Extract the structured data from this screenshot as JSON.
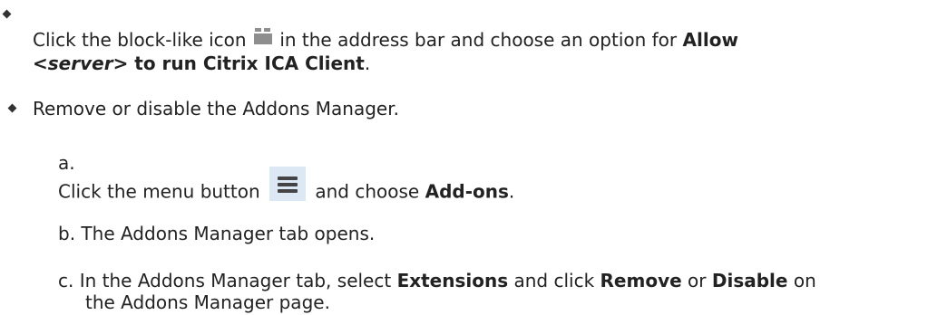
{
  "items": [
    {
      "line1_before": "Click the block-like icon",
      "line1_after": "in the address bar and choose an option for",
      "line1_bold": "Allow",
      "line2_bold_lt": "<",
      "line2_italic": "server",
      "line2_bold_rest": "> to run Citrix ICA Client",
      "line2_end": ".",
      "icon": "block-puzzle-icon"
    },
    {
      "text": "Remove or disable the Addons Manager."
    }
  ],
  "substeps": [
    {
      "marker": "a.",
      "before": "Click the menu button",
      "middle": "and choose",
      "bold": "Add-ons",
      "end": ".",
      "icon": "hamburger-menu-icon"
    },
    {
      "marker": "b.",
      "text": "The Addons Manager tab opens."
    },
    {
      "marker": "c.",
      "line1_before": "In the Addons Manager tab, select",
      "bold1": "Extensions",
      "mid1": "and click",
      "bold2": "Remove",
      "mid2": "or",
      "bold3": "Disable",
      "line1_end": "on",
      "line2": "the Addons Manager page."
    }
  ]
}
